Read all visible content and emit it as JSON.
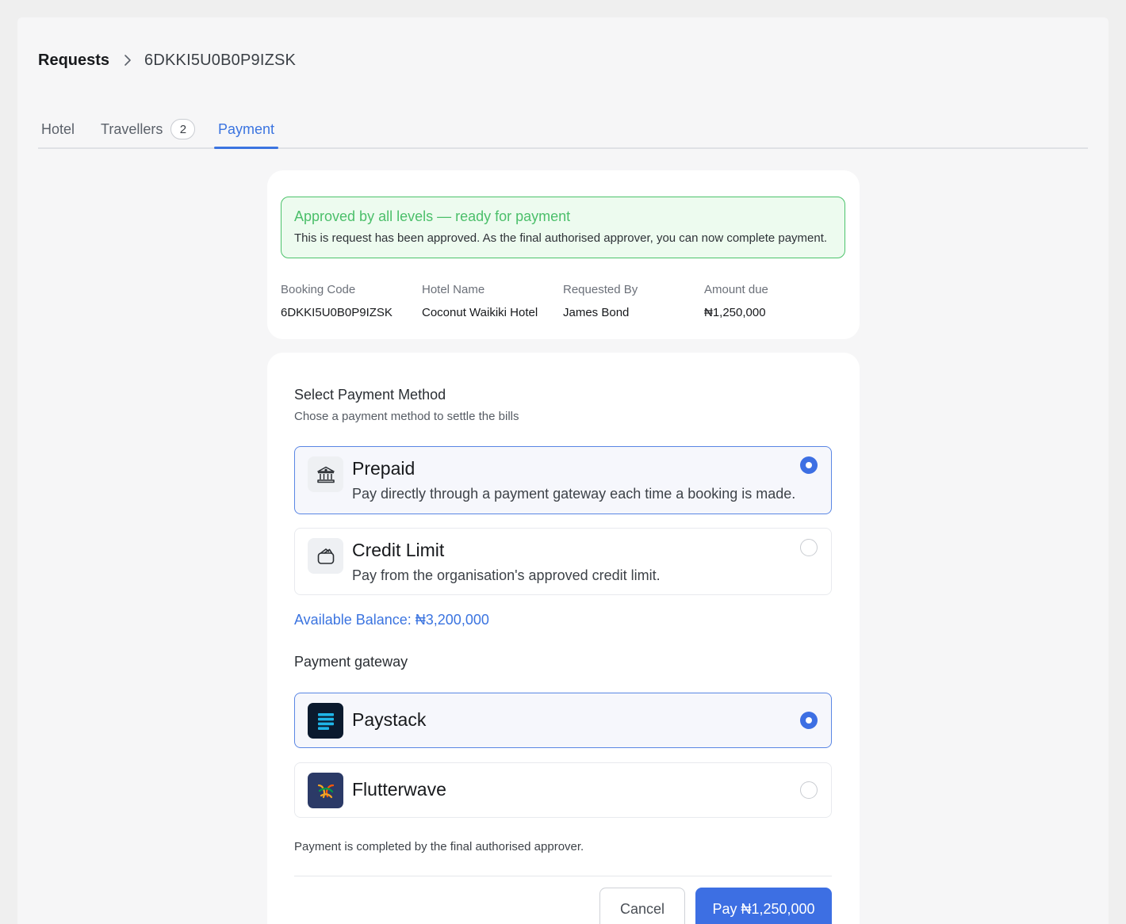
{
  "breadcrumb": {
    "root": "Requests",
    "current": "6DKKI5U0B0P9IZSK"
  },
  "tabs": {
    "hotel": "Hotel",
    "travellers": "Travellers",
    "travellers_count": "2",
    "payment": "Payment",
    "active": "Payment"
  },
  "summary": {
    "alert": {
      "title": "Approved by all levels — ready for payment",
      "description": "This is request has been approved. As the final authorised approver, you can now complete payment."
    },
    "fields": [
      {
        "label": "Booking Code",
        "value": "6DKKI5U0B0P9IZSK"
      },
      {
        "label": "Hotel Name",
        "value": "Coconut Waikiki Hotel"
      },
      {
        "label": "Requested By",
        "value": "James Bond"
      },
      {
        "label": "Amount due",
        "value": "₦1,250,000"
      }
    ]
  },
  "payment": {
    "title": "Select Payment Method",
    "subtitle": "Chose a payment method to settle the bills",
    "methods": [
      {
        "icon": "bank-icon",
        "title": "Prepaid",
        "description": "Pay directly through a payment gateway each time a booking is made.",
        "selected": true
      },
      {
        "icon": "wallet-icon",
        "title": "Credit Limit",
        "description": "Pay from the organisation's approved credit limit.",
        "selected": false
      }
    ],
    "available_balance": "Available Balance: ₦3,200,000",
    "gateway_heading": "Payment gateway",
    "gateways": [
      {
        "icon": "paystack-logo",
        "name": "Paystack",
        "selected": true
      },
      {
        "icon": "flutterwave-logo",
        "name": "Flutterwave",
        "selected": false
      }
    ],
    "footnote": "Payment is completed by the final authorised approver.",
    "cancel_label": "Cancel",
    "pay_label": "Pay ₦1,250,000"
  },
  "colors": {
    "accent": "#3d6fe3",
    "success": "#4bbf6a",
    "success_bg": "#edfbef"
  }
}
